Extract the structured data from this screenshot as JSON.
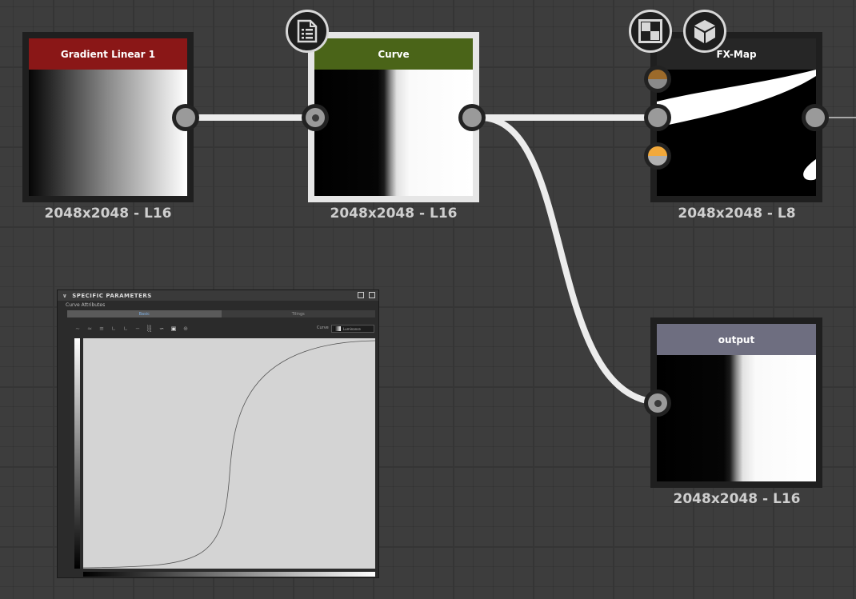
{
  "nodes": {
    "gradient": {
      "title": "Gradient Linear 1",
      "resolution": "2048x2048 - L16",
      "title_color": "#8a1717"
    },
    "curve": {
      "title": "Curve",
      "resolution": "2048x2048 - L16",
      "title_color": "#4a6418"
    },
    "fxmap": {
      "title": "FX-Map",
      "resolution": "2048x2048 - L8",
      "title_color": "#262626"
    },
    "output": {
      "title": "output",
      "resolution": "2048x2048 - L16",
      "title_color": "#6e6e80"
    }
  },
  "params_panel": {
    "header": "SPECIFIC PARAMETERS",
    "subtitle": "Curve Attributes",
    "tabs": [
      {
        "label": "Basic",
        "active": true
      },
      {
        "label": "Tilings",
        "active": false
      }
    ],
    "channel_label": "Curve",
    "channel_value": "Luminance"
  },
  "icons": {
    "curve_node_badge": "document-list-icon",
    "fxmap_badges": [
      "checker-icon",
      "cube-icon"
    ]
  },
  "colors": {
    "wire": "#ececec",
    "port_orange": "#f2a93b",
    "port_dark_orange": "#9c6a2a"
  }
}
